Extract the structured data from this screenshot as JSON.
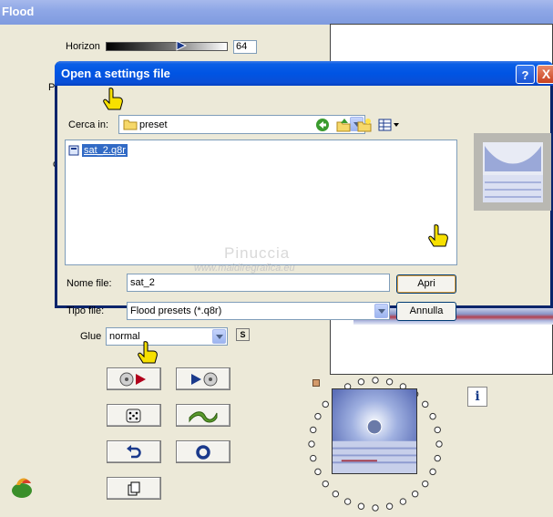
{
  "app": {
    "title": "Flood"
  },
  "horizon": {
    "label": "Horizon",
    "value": "64",
    "level_fraction": 0.63
  },
  "cut_labels": {
    "p": "P",
    "c": "c"
  },
  "glue": {
    "label": "Glue",
    "value": "normal",
    "s_button": "S"
  },
  "buttons": {
    "load_preset": "load-preset-icon",
    "save_preset": "save-preset-icon",
    "random": "dice-icon",
    "wave": "wave-icon",
    "reset": "undo-icon",
    "circle": "ring-icon",
    "copy": "copy-icon"
  },
  "dialog": {
    "title": "Open a settings file",
    "help": "?",
    "close": "X",
    "look_in_label": "Cerca in:",
    "look_in_value": "preset",
    "files": [
      {
        "name": "sat_2.q8r",
        "selected": true
      }
    ],
    "file_name_label": "Nome file:",
    "file_name_value": "sat_2",
    "file_type_label": "Tipo file:",
    "file_type_value": "Flood presets (*.q8r)",
    "open_button": "Apri",
    "cancel_button": "Annulla"
  },
  "watermark": {
    "line1": "Pinuccia",
    "line2": "www.maidiregrafica.eu"
  },
  "info": {
    "label": "i"
  },
  "colors": {
    "xp_blue": "#0054e3",
    "dialog_bg": "#ece9d8",
    "selection": "#316ac5"
  }
}
